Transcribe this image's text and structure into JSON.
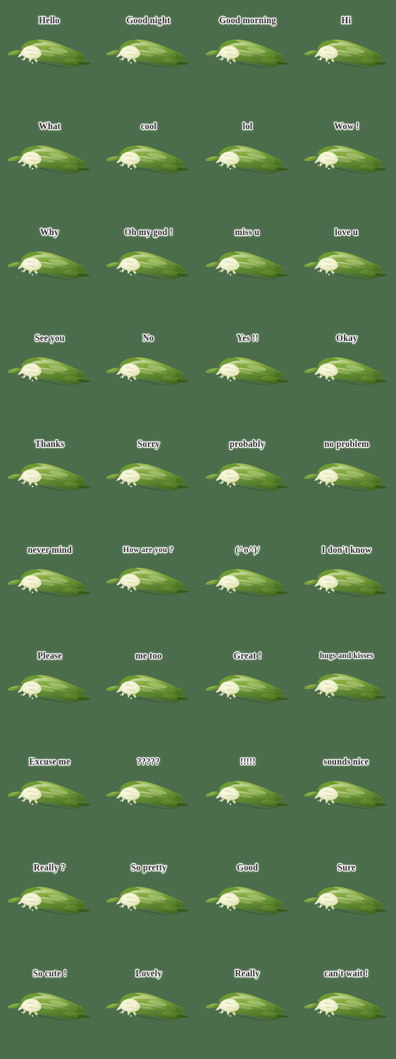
{
  "sheet": {
    "background_color": "#4b6d4b",
    "columns": 4,
    "rows": 10,
    "sticker_image_name": "green-chili-pepper",
    "caption_text_color": "#2b2b2b",
    "caption_outline_color": "#ffffff"
  },
  "stickers": [
    {
      "caption": "Hello"
    },
    {
      "caption": "Good night"
    },
    {
      "caption": "Good morning"
    },
    {
      "caption": "Hi"
    },
    {
      "caption": "What"
    },
    {
      "caption": "cool"
    },
    {
      "caption": "lol"
    },
    {
      "caption": "Wow !"
    },
    {
      "caption": "Why"
    },
    {
      "caption": "Oh my god !"
    },
    {
      "caption": "miss u"
    },
    {
      "caption": "love u"
    },
    {
      "caption": "See you"
    },
    {
      "caption": "No"
    },
    {
      "caption": "Yes !!"
    },
    {
      "caption": "Okay"
    },
    {
      "caption": "Thanks"
    },
    {
      "caption": "Sorry"
    },
    {
      "caption": "probably"
    },
    {
      "caption": "no problem"
    },
    {
      "caption": "never mind"
    },
    {
      "caption": "How are you ?"
    },
    {
      "caption": "(^o^)/"
    },
    {
      "caption": "I don't know"
    },
    {
      "caption": "Please"
    },
    {
      "caption": "me too"
    },
    {
      "caption": "Great !"
    },
    {
      "caption": "hugs and kisses"
    },
    {
      "caption": "Excuse me"
    },
    {
      "caption": "?????"
    },
    {
      "caption": "!!!!!"
    },
    {
      "caption": "sounds  nice"
    },
    {
      "caption": "Really ?"
    },
    {
      "caption": "So pretty"
    },
    {
      "caption": "Good"
    },
    {
      "caption": "Sure"
    },
    {
      "caption": "So cute !"
    },
    {
      "caption": "Lovely"
    },
    {
      "caption": "Really"
    },
    {
      "caption": "can't wait !"
    }
  ]
}
